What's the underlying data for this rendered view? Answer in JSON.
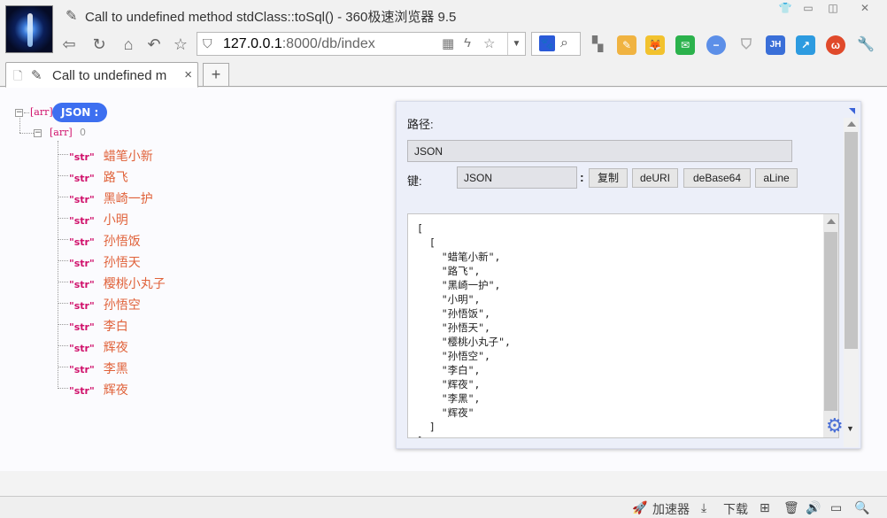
{
  "window": {
    "title": "Call to undefined method stdClass::toSql() - 360极速浏览器 9.5",
    "controls": [
      "shirt-icon",
      "minimize",
      "restore",
      "close"
    ]
  },
  "toolbar": {
    "url_host": "127.0.0.1",
    "url_path": ":8000/db/index"
  },
  "tab": {
    "label": "Call to undefined m",
    "close": "×",
    "new_tab": "+"
  },
  "tree": {
    "root_tag": "[arr]",
    "root_label": "JSON :",
    "child_tag": "[arr]",
    "child_count": "0",
    "items": [
      {
        "type": "\"str\"",
        "value": "蜡笔小新"
      },
      {
        "type": "\"str\"",
        "value": "路飞"
      },
      {
        "type": "\"str\"",
        "value": "黑崎一护"
      },
      {
        "type": "\"str\"",
        "value": "小明"
      },
      {
        "type": "\"str\"",
        "value": "孙悟饭"
      },
      {
        "type": "\"str\"",
        "value": "孙悟天"
      },
      {
        "type": "\"str\"",
        "value": "樱桃小丸子"
      },
      {
        "type": "\"str\"",
        "value": "孙悟空"
      },
      {
        "type": "\"str\"",
        "value": "李白"
      },
      {
        "type": "\"str\"",
        "value": "辉夜"
      },
      {
        "type": "\"str\"",
        "value": "李黑"
      },
      {
        "type": "\"str\"",
        "value": "辉夜"
      }
    ]
  },
  "panel": {
    "path_label": "路径:",
    "path_value": "JSON",
    "key_label": "键:",
    "key_value": "JSON",
    "buttons": [
      "复制",
      "deURI",
      "deBase64",
      "aLine"
    ],
    "json_text": "[\n  [\n    \"蜡笔小新\",\n    \"路飞\",\n    \"黑崎一护\",\n    \"小明\",\n    \"孙悟饭\",\n    \"孙悟天\",\n    \"樱桃小丸子\",\n    \"孙悟空\",\n    \"李白\",\n    \"辉夜\",\n    \"李黑\",\n    \"辉夜\"\n  ]\n]"
  },
  "statusbar": {
    "accelerator": "加速器",
    "download": "下载"
  },
  "colors": {
    "accent": "#3d6ff0",
    "tag": "#d0116b",
    "value": "#e0623a"
  }
}
